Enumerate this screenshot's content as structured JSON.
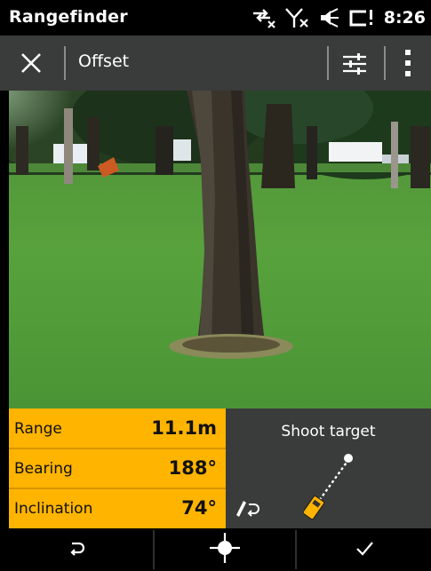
{
  "statusbar": {
    "app_title": "Rangefinder",
    "time": "8:26",
    "icons": [
      "data-transfer-off-icon",
      "signal-off-icon",
      "volume-icon",
      "battery-icon"
    ]
  },
  "toolbar": {
    "title": "Offset",
    "icons": [
      "close-icon",
      "settings-sliders-icon",
      "more-vertical-icon"
    ]
  },
  "readings": [
    {
      "label": "Range",
      "value": "11.1m"
    },
    {
      "label": "Bearing",
      "value": "188°"
    },
    {
      "label": "Inclination",
      "value": "74°"
    }
  ],
  "shoot_panel": {
    "label": "Shoot target",
    "icons": [
      "laser-rangefinder-icon",
      "edit-return-icon"
    ]
  },
  "bottom_nav": {
    "icons": [
      "back-icon",
      "crosshair-icon",
      "check-icon"
    ]
  },
  "colors": {
    "accent": "#ffb400",
    "toolbar_bg": "#3a3b3b",
    "status_bg": "#000000"
  }
}
